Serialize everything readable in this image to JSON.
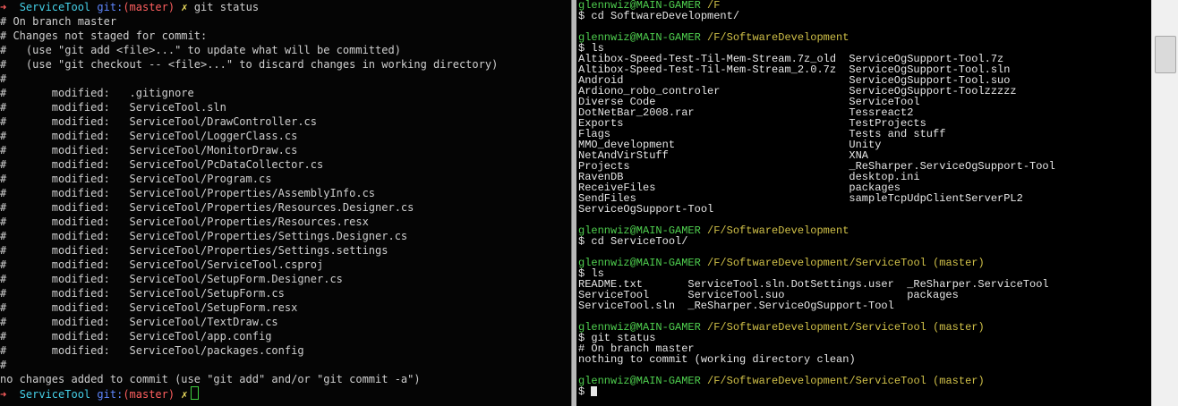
{
  "left_terminal": {
    "prompt_arrow": "➜",
    "dir": "ServiceTool",
    "git_label": "git:",
    "branch": "(master)",
    "x_mark": "✗",
    "command": "git status",
    "output": [
      "# On branch master",
      "# Changes not staged for commit:",
      "#   (use \"git add <file>...\" to update what will be committed)",
      "#   (use \"git checkout -- <file>...\" to discard changes in working directory)",
      "#",
      "#       modified:   .gitignore",
      "#       modified:   ServiceTool.sln",
      "#       modified:   ServiceTool/DrawController.cs",
      "#       modified:   ServiceTool/LoggerClass.cs",
      "#       modified:   ServiceTool/MonitorDraw.cs",
      "#       modified:   ServiceTool/PcDataCollector.cs",
      "#       modified:   ServiceTool/Program.cs",
      "#       modified:   ServiceTool/Properties/AssemblyInfo.cs",
      "#       modified:   ServiceTool/Properties/Resources.Designer.cs",
      "#       modified:   ServiceTool/Properties/Resources.resx",
      "#       modified:   ServiceTool/Properties/Settings.Designer.cs",
      "#       modified:   ServiceTool/Properties/Settings.settings",
      "#       modified:   ServiceTool/ServiceTool.csproj",
      "#       modified:   ServiceTool/SetupForm.Designer.cs",
      "#       modified:   ServiceTool/SetupForm.cs",
      "#       modified:   ServiceTool/SetupForm.resx",
      "#       modified:   ServiceTool/TextDraw.cs",
      "#       modified:   ServiceTool/app.config",
      "#       modified:   ServiceTool/packages.config",
      "#",
      "no changes added to commit (use \"git add\" and/or \"git commit -a\")"
    ]
  },
  "right_terminal": {
    "user_host": "glennwiz@MAIN-GAMER",
    "prompt_symbol": "$",
    "blocks": [
      {
        "path": "/F",
        "command": "cd SoftwareDevelopment/",
        "output": []
      },
      {
        "path": "/F/SoftwareDevelopment",
        "command": "ls",
        "columns": [
          [
            "Altibox-Speed-Test-Til-Mem-Stream.7z_old",
            "Altibox-Speed-Test-Til-Mem-Stream_2.0.7z",
            "Android",
            "Ardiono_robo_controler",
            "Diverse Code",
            "DotNetBar_2008.rar",
            "Exports",
            "Flags",
            "MMO_development",
            "NetAndVirStuff",
            "Projects",
            "RavenDB",
            "ReceiveFiles",
            "SendFiles",
            "ServiceOgSupport-Tool"
          ],
          [
            "ServiceOgSupport-Tool.7z",
            "ServiceOgSupport-Tool.sln",
            "ServiceOgSupport-Tool.suo",
            "ServiceOgSupport-Toolzzzzz",
            "ServiceTool",
            "Tessreact2",
            "TestProjects",
            "Tests and stuff",
            "Unity",
            "XNA",
            "_ReSharper.ServiceOgSupport-Tool",
            "desktop.ini",
            "packages",
            "sampleTcpUdpClientServerPL2",
            ""
          ]
        ]
      },
      {
        "path": "/F/SoftwareDevelopment",
        "command": "cd ServiceTool/",
        "output": []
      },
      {
        "path": "/F/SoftwareDevelopment/ServiceTool (master)",
        "command": "ls",
        "columns": [
          [
            "README.txt",
            "ServiceTool",
            "ServiceTool.sln"
          ],
          [
            "ServiceTool.sln.DotSettings.user",
            "ServiceTool.suo",
            "_ReSharper.ServiceOgSupport-Tool"
          ],
          [
            "_ReSharper.ServiceTool",
            "packages",
            ""
          ]
        ]
      },
      {
        "path": "/F/SoftwareDevelopment/ServiceTool (master)",
        "command": "git status",
        "output": [
          "# On branch master",
          "nothing to commit (working directory clean)"
        ]
      },
      {
        "path": "/F/SoftwareDevelopment/ServiceTool (master)",
        "command": "",
        "output": []
      }
    ]
  },
  "colors": {
    "left_bg": "#050505",
    "right_bg": "#000000",
    "user_green": "#4fd04f",
    "path_yellow": "#d0c048",
    "dir_cyan": "#45d0e8",
    "git_blue": "#5f87ff",
    "branch_red": "#ff5f5f"
  }
}
